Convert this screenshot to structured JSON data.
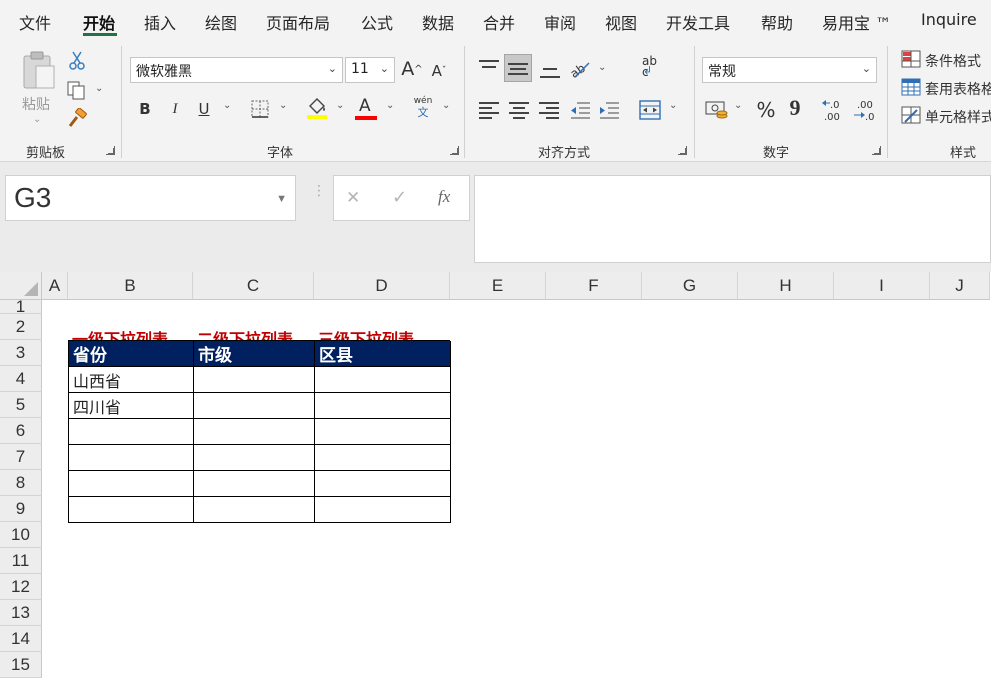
{
  "menu": {
    "tabs": [
      "文件",
      "开始",
      "插入",
      "绘图",
      "页面布局",
      "公式",
      "数据",
      "合并",
      "审阅",
      "视图",
      "开发工具",
      "帮助",
      "易用宝 ™",
      "Inquire"
    ],
    "active_index": 1
  },
  "ribbon": {
    "clipboard": {
      "paste_label": "粘贴",
      "group_label": "剪贴板"
    },
    "font": {
      "font_name": "微软雅黑",
      "font_size": "11",
      "group_label": "字体",
      "bold": "B",
      "italic": "I",
      "underline": "U",
      "phonetic_top": "wén",
      "phonetic_bottom": "文",
      "font_color_letter": "A"
    },
    "alignment": {
      "group_label": "对齐方式",
      "wrap_icon_text": "ab c"
    },
    "number": {
      "format": "常规",
      "group_label": "数字",
      "percent": "%",
      "comma": "9"
    },
    "styles": {
      "group_label": "样式",
      "items": [
        "条件格式",
        "套用表格格式",
        "单元格样式"
      ]
    }
  },
  "formula_bar": {
    "name_box": "G3",
    "cancel": "✕",
    "enter": "✓",
    "fx": "fx",
    "formula": ""
  },
  "grid": {
    "columns": [
      "A",
      "B",
      "C",
      "D",
      "E",
      "F",
      "G",
      "H",
      "I",
      "J"
    ],
    "rows": [
      "1",
      "2",
      "3",
      "4",
      "5",
      "6",
      "7",
      "8",
      "9",
      "10",
      "11",
      "12",
      "13",
      "14",
      "15"
    ],
    "labels": [
      "一级下拉列表",
      "二级下拉列表",
      "三级下拉列表"
    ],
    "table": {
      "headers": [
        "省份",
        "市级",
        "区县"
      ],
      "rows": [
        [
          "山西省",
          "",
          ""
        ],
        [
          "四川省",
          "",
          ""
        ],
        [
          "",
          "",
          ""
        ],
        [
          "",
          "",
          ""
        ],
        [
          "",
          "",
          ""
        ],
        [
          "",
          "",
          ""
        ]
      ]
    }
  },
  "colors": {
    "accent": "#217346",
    "header_fill": "#002060",
    "label_red": "#c00000",
    "highlight_yellow": "#ffff00",
    "font_red": "#ff0000"
  }
}
